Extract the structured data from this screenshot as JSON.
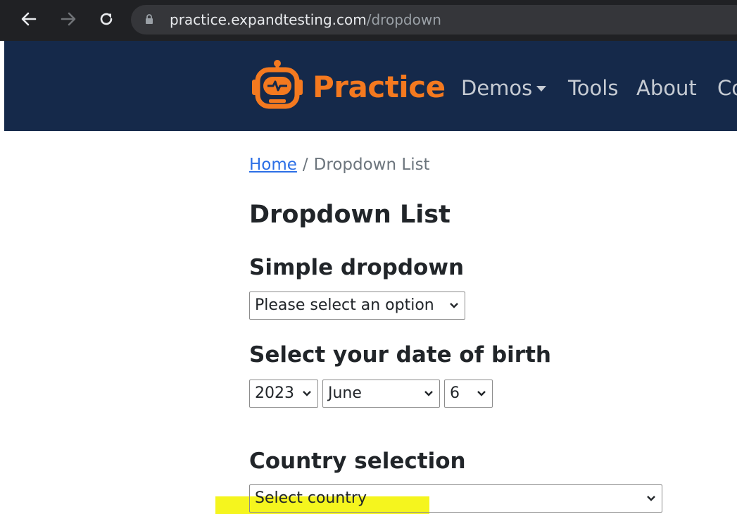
{
  "browser": {
    "url_host": "practice.expandtesting.com",
    "url_path": "/dropdown"
  },
  "navbar": {
    "brand": "Practice",
    "links": [
      "Demos",
      "Tools",
      "About",
      "Co"
    ]
  },
  "breadcrumb": {
    "home": "Home",
    "separator": "/",
    "current": "Dropdown List"
  },
  "page": {
    "title": "Dropdown List",
    "simple_dropdown": {
      "heading": "Simple dropdown",
      "value": "Please select an option"
    },
    "date_of_birth": {
      "heading": "Select your date of birth",
      "year": "2023",
      "month": "June",
      "day": "6"
    },
    "country": {
      "heading": "Country selection",
      "value": "Select country"
    }
  },
  "colors": {
    "browser_bar": "#202124",
    "navbar_bg": "#15294a",
    "brand_orange": "#f4791f",
    "link_blue": "#2c6fe6",
    "highlight": "#f5f51e"
  }
}
